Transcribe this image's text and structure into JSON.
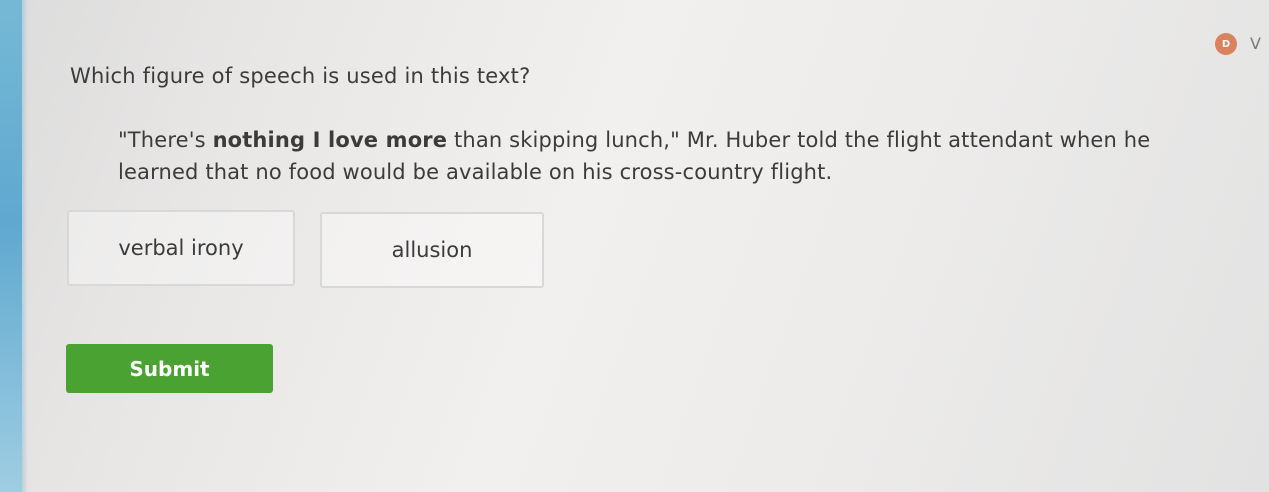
{
  "header": {
    "badge_text": "D",
    "chevron": "V"
  },
  "question": {
    "prompt": "Which figure of speech is used in this text?",
    "passage": {
      "before": "\"There's ",
      "emphasis": "nothing I love more",
      "after": " than skipping lunch,\" Mr. Huber told the flight attendant when he learned that no food would be available on his cross-country flight."
    }
  },
  "options": [
    {
      "label": "verbal irony"
    },
    {
      "label": "allusion"
    }
  ],
  "submit": {
    "label": "Submit"
  },
  "colors": {
    "submit_bg": "#4aa232",
    "badge_bg": "#d9825d",
    "left_accent": "#5fa8cf"
  }
}
